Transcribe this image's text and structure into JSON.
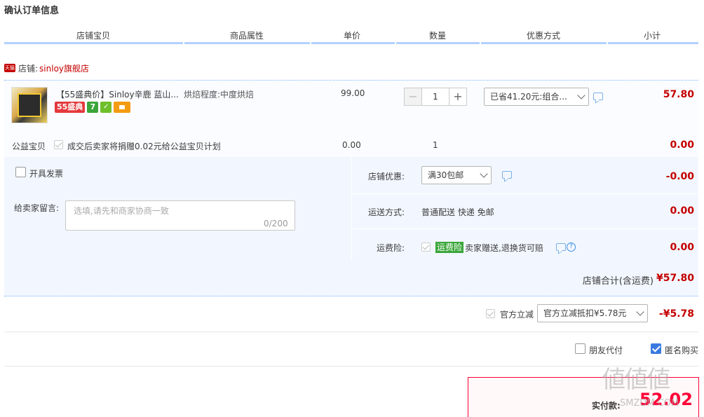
{
  "page_title": "确认订单信息",
  "columns": [
    "店铺宝贝",
    "商品属性",
    "单价",
    "数量",
    "优惠方式",
    "小计"
  ],
  "shop": {
    "badge": "天猫",
    "label": "店铺:",
    "name": "sinloy旗舰店"
  },
  "product": {
    "title": "【55盛典价】Sinloy辛鹿 蓝山...",
    "tag_55": "55盛典",
    "tag_7": "7",
    "tag_shield": "✓",
    "attribute": "烘焙程度:中度烘焙",
    "price": "99.00",
    "quantity": "1",
    "qty_minus": "−",
    "qty_plus": "+",
    "discount_select": "已省41.20元:组合...",
    "subtotal": "57.80"
  },
  "charity": {
    "label": "公益宝贝",
    "text": "成交后卖家将捐赠0.02元给公益宝贝计划",
    "price": "0.00",
    "quantity": "1",
    "subtotal": "0.00"
  },
  "invoice": {
    "label": "开具发票"
  },
  "message": {
    "label": "给卖家留言:",
    "placeholder": "选填,请先和商家协商一致",
    "count": "0/200"
  },
  "shop_discount": {
    "label": "店铺优惠:",
    "select": "满30包邮",
    "amount": "-0.00"
  },
  "delivery": {
    "label": "运送方式:",
    "value": "普通配送 快递 免邮",
    "amount": "0.00"
  },
  "insurance": {
    "label": "运费险:",
    "tag": "运费险",
    "text": "卖家赠送,退换货可赔",
    "help": "?",
    "amount": "0.00"
  },
  "shop_total": {
    "label": "店铺合计(含运费)",
    "value": "¥57.80"
  },
  "official": {
    "label": "官方立减",
    "select": "官方立减抵扣¥5.78元",
    "amount": "-¥5.78"
  },
  "options": {
    "friend_pay": "朋友代付",
    "anonymous": "匿名购买"
  },
  "payment": {
    "label": "实付款:",
    "value": "52.02"
  },
  "watermark": {
    "logo": "値値値",
    "sub": "SMZDM.COM"
  },
  "colors": {
    "accent": "#c40000",
    "header_line": "#b2d1ff",
    "panel_bg": "#f2f7ff",
    "pay_red": "#ff0036"
  }
}
